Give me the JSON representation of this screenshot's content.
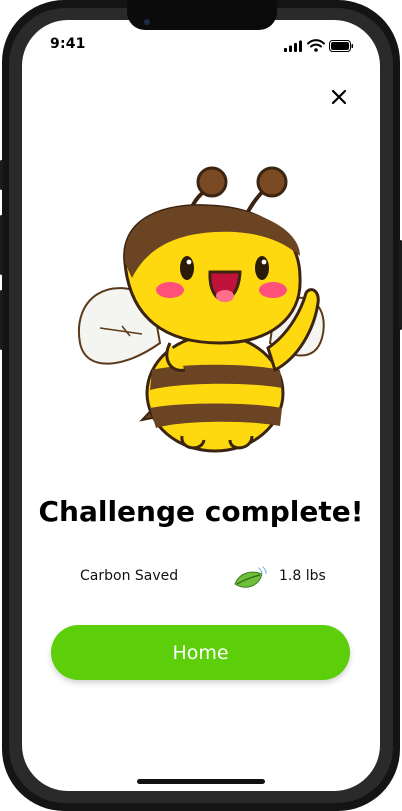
{
  "status_bar": {
    "time": "9:41",
    "icons": [
      "signal-icon",
      "wifi-icon",
      "battery-icon"
    ]
  },
  "header": {
    "close_icon": "close-icon"
  },
  "illustration": {
    "icon": "bee-mascot-illustration"
  },
  "main": {
    "title": "Challenge complete!",
    "stat": {
      "label": "Carbon Saved",
      "icon": "leaf-icon",
      "value": "1.8 lbs"
    }
  },
  "actions": {
    "home_label": "Home"
  },
  "colors": {
    "accent": "#5ccf0a",
    "text": "#000000",
    "background": "#ffffff"
  }
}
